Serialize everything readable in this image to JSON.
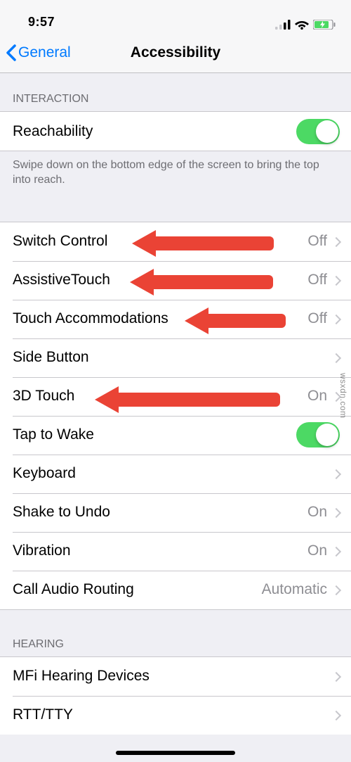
{
  "status": {
    "time": "9:57"
  },
  "nav": {
    "back": "General",
    "title": "Accessibility"
  },
  "section_interaction": {
    "header": "INTERACTION",
    "rows": {
      "reachability": {
        "label": "Reachability"
      }
    },
    "footer": "Swipe down on the bottom edge of the screen to bring the top into reach."
  },
  "section_items": {
    "switch_control": {
      "label": "Switch Control",
      "value": "Off"
    },
    "assistivetouch": {
      "label": "AssistiveTouch",
      "value": "Off"
    },
    "touch_accommodations": {
      "label": "Touch Accommodations",
      "value": "Off"
    },
    "side_button": {
      "label": "Side Button"
    },
    "3d_touch": {
      "label": "3D Touch",
      "value": "On"
    },
    "tap_to_wake": {
      "label": "Tap to Wake"
    },
    "keyboard": {
      "label": "Keyboard"
    },
    "shake_to_undo": {
      "label": "Shake to Undo",
      "value": "On"
    },
    "vibration": {
      "label": "Vibration",
      "value": "On"
    },
    "call_audio_routing": {
      "label": "Call Audio Routing",
      "value": "Automatic"
    }
  },
  "section_hearing": {
    "header": "HEARING",
    "mfi": {
      "label": "MFi Hearing Devices"
    },
    "rtt": {
      "label": "RTT/TTY"
    }
  },
  "watermark": "wsxdn.com"
}
